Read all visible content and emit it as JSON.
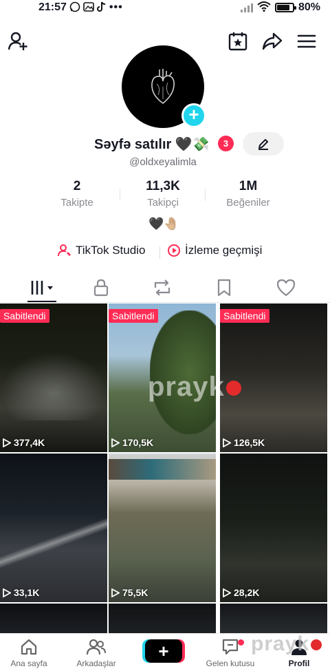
{
  "status_bar": {
    "time": "21:57",
    "battery": "80%",
    "battery_level": 0.8
  },
  "profile": {
    "display_name": "Səyfə satılır 🖤💸",
    "badge_count": "3",
    "username": "@oldxeyalimla",
    "bio_emoji": "🖤🤚🏼",
    "stats": [
      {
        "value": "2",
        "label": "Takipte"
      },
      {
        "value": "11,3K",
        "label": "Takipçi"
      },
      {
        "value": "1M",
        "label": "Beğeniler"
      }
    ]
  },
  "links": {
    "studio": "TikTok Studio",
    "history": "İzleme geçmişi"
  },
  "videos": [
    {
      "pinned": true,
      "pin_label": "Sabitlendi",
      "views": "377,4K"
    },
    {
      "pinned": true,
      "pin_label": "Sabitlendi",
      "views": "170,5K"
    },
    {
      "pinned": true,
      "pin_label": "Sabitlendi",
      "views": "126,5K"
    },
    {
      "pinned": false,
      "views": "33,1K"
    },
    {
      "pinned": false,
      "views": "75,5K"
    },
    {
      "pinned": false,
      "views": "28,2K"
    }
  ],
  "watermark": "prayk",
  "bottom_nav": [
    {
      "label": "Ana sayfa"
    },
    {
      "label": "Arkadaşlar"
    },
    {
      "label": "Gelen kutusu"
    },
    {
      "label": "Profil"
    }
  ],
  "colors": {
    "accent_red": "#fe2c55",
    "accent_cyan": "#20d5ec",
    "text": "#161823"
  }
}
